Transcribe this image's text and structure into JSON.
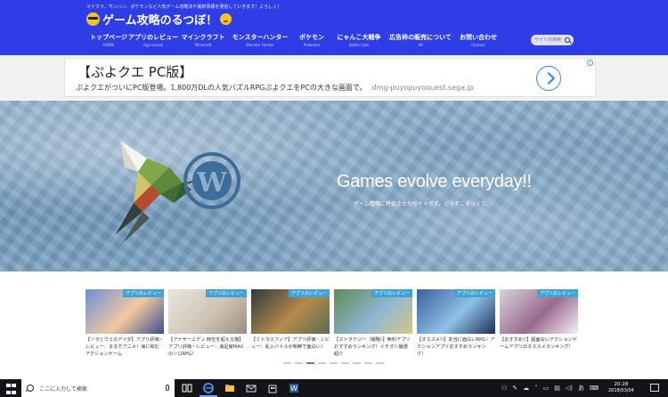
{
  "header": {
    "tagline": "マイクラ、モンハン、ポケモンなど人気ゲーム攻略法や最新情報を発信していきます！よろしく！",
    "site_title": "ゲーム攻略のるつぼ！"
  },
  "nav": {
    "items": [
      {
        "ja": "トップページ",
        "en": "HOME",
        "w": 44
      },
      {
        "ja": "アプリのレビュー",
        "en": "App review",
        "w": 56
      },
      {
        "ja": "マインクラフト",
        "en": "Minecraft",
        "w": 56
      },
      {
        "ja": "モンスターハンター",
        "en": "Monster Hunter",
        "w": 72
      },
      {
        "ja": "ポケモン",
        "en": "Pokemon",
        "w": 44
      },
      {
        "ja": "にゃんこ大戦争",
        "en": "Battle Cats",
        "w": 62
      },
      {
        "ja": "広告枠の販売について",
        "en": "Ad",
        "w": 76
      },
      {
        "ja": "お問い合わせ",
        "en": "Contact",
        "w": 54
      }
    ],
    "search_placeholder": "サイト内検索"
  },
  "ad": {
    "title": "【ぷよクエ PC版】",
    "body": "ぷよクエがついにPC版登場。1,800万DLの人気パズルRPGぷよクエをPCの大きな画面で。",
    "url": "dmg-puyopuyoquest.sega.jp"
  },
  "hero": {
    "title": "Games evolve everyday!!",
    "subtitle": "ゲーム情報に特化させたサイトです。どうぞごゆっくり。"
  },
  "cards": [
    {
      "badge": "アプリのレビュー",
      "title": "【ソラとウミのアイダ】アプリ評価・レビュー：まるでアニメ！海に和むアクションゲーム",
      "colors": [
        "#6d8fd6",
        "#f2c9a0",
        "#3b4f8f"
      ]
    },
    {
      "badge": "アプリのレビュー",
      "title": "【アナザーエデン 時空を超える猫】アプリ評価・レビュー：満足度MAXのソロRPG！",
      "colors": [
        "#e9e5de",
        "#cfc4b4",
        "#9a8e80"
      ]
    },
    {
      "badge": "アプリのレビュー",
      "title": "【ミトラスフィア】アプリ評価・レビュー：乱入バトルが新鮮で面白い！",
      "colors": [
        "#2e3a3f",
        "#b58a4c",
        "#5a6b4e"
      ]
    },
    {
      "badge": "アプリのレビュー",
      "title": "【ストラテジー（戦略）】無料アプリおすすめランキング！イチオシ厳選紹介",
      "colors": [
        "#5c8a5a",
        "#8fb6d1",
        "#d6c68a"
      ]
    },
    {
      "badge": "アプリのレビュー",
      "title": "【オススメ!!】本当に面白いRPG・アクションアプリおすすめランキング！",
      "colors": [
        "#3c5fa0",
        "#8ec1e6",
        "#1f2f58"
      ]
    },
    {
      "badge": "アプリのレビュー",
      "title": "【おすすめ!!】超面白いアクションゲームアプリのオススメランキング！",
      "colors": [
        "#d7d3dc",
        "#9a6a8e",
        "#f4f1f6"
      ]
    }
  ],
  "taskbar": {
    "search_text": "ここに入力して検索",
    "ime": "あ",
    "time": "20:28",
    "date": "2018/03/04"
  },
  "colors": {
    "header_bg": "#2f3de6",
    "badge": "#3fa3d8"
  }
}
